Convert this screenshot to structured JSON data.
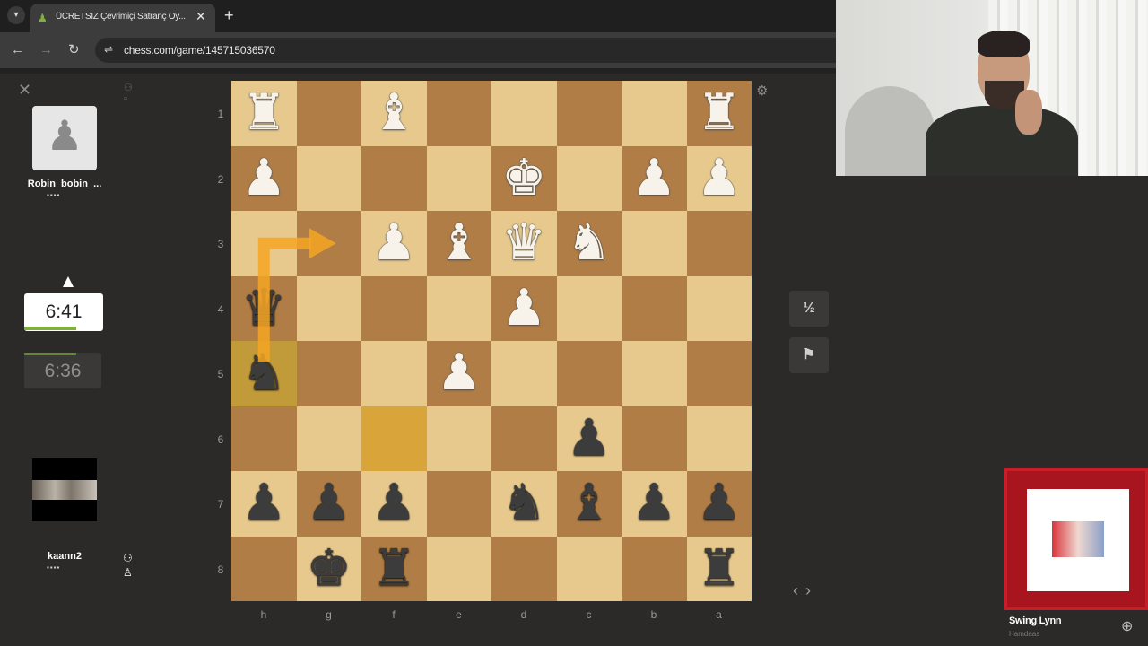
{
  "browser": {
    "tab_title": "ÜCRETSİZ Çevrimiçi Satranç Oy...",
    "tab_close": "✕",
    "new_tab": "+",
    "url": "chess.com/game/145715036570",
    "back": "←",
    "forward": "→",
    "reload": "↻",
    "site_info": "⇌"
  },
  "left_panel": {
    "close": "✕",
    "opponent": {
      "name": "Robin_bobin_...",
      "flags": "▪▪▪▪"
    },
    "opponent_clock": "6:41",
    "my_clock": "6:36",
    "me": {
      "name": "kaann2",
      "flags": "▪▪▪▪"
    }
  },
  "board": {
    "ranks": [
      "1",
      "2",
      "3",
      "4",
      "5",
      "6",
      "7",
      "8"
    ],
    "files": [
      "h",
      "g",
      "f",
      "e",
      "d",
      "c",
      "b",
      "a"
    ],
    "rows": [
      [
        "wR",
        "",
        "wB",
        "",
        "",
        "",
        "",
        "wR"
      ],
      [
        "wP",
        "",
        "",
        "",
        "wK",
        "",
        "wP",
        "wP"
      ],
      [
        "",
        "",
        "wP",
        "wB",
        "wQ",
        "wN",
        "",
        ""
      ],
      [
        "bQ",
        "",
        "",
        "",
        "wP",
        "",
        "",
        ""
      ],
      [
        "bN",
        "",
        "",
        "wP",
        "",
        "",
        "",
        ""
      ],
      [
        "",
        "",
        "",
        "",
        "",
        "bP",
        "",
        ""
      ],
      [
        "bP",
        "bP",
        "bP",
        "",
        "bN",
        "bB",
        "bP",
        "bP"
      ],
      [
        "",
        "bK",
        "bR",
        "",
        "",
        "",
        "",
        "bR"
      ]
    ],
    "highlight_squares": [
      "h5",
      "f6"
    ],
    "arrow": {
      "from": "h4",
      "to": "g3",
      "color": "#f5a623"
    }
  },
  "controls": {
    "settings": "⚙",
    "draw": "½",
    "resign": "⚑",
    "prev": "‹",
    "next": "›"
  },
  "promo": {
    "name": "Swing Lynn",
    "sub": "Hamdaas"
  },
  "colors": {
    "light_square": "#e7c98e",
    "dark_square": "#b07d46",
    "highlight": "#d9a53a",
    "arrow": "#f5a623",
    "clock_bar": "#7fb03f",
    "promo_red": "#a8151f"
  }
}
